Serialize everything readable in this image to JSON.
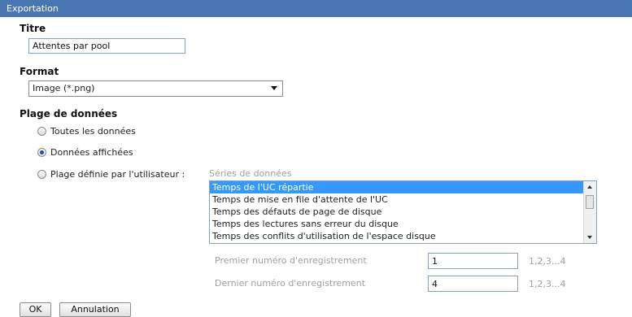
{
  "window": {
    "title": "Exportation"
  },
  "title_section": {
    "label": "Titre",
    "value": "Attentes par pool"
  },
  "format_section": {
    "label": "Format",
    "selected": "Image (*.png)"
  },
  "range_section": {
    "label": "Plage de données",
    "options": [
      "Toutes les données",
      "Données affichées",
      "Plage définie par l'utilisateur :"
    ],
    "selected_index": 1
  },
  "series": {
    "caption": "Séries de données",
    "items": [
      "Temps de l'UC répartie",
      "Temps de mise en file d'attente de l'UC",
      "Temps des défauts de page de disque",
      "Temps des lectures sans erreur du disque",
      "Temps des conflits d'utilisation de l'espace disque"
    ],
    "selected_index": 0
  },
  "records": {
    "first": {
      "label": "Premier numéro d'enregistrement",
      "value": "1",
      "hint": "1,2,3...4"
    },
    "last": {
      "label": "Dernier numéro d'enregistrement",
      "value": "4",
      "hint": "1,2,3...4"
    }
  },
  "buttons": {
    "ok": "OK",
    "cancel": "Annulation"
  },
  "colors": {
    "titlebar": "#4a76b1",
    "selection": "#3399ff"
  }
}
